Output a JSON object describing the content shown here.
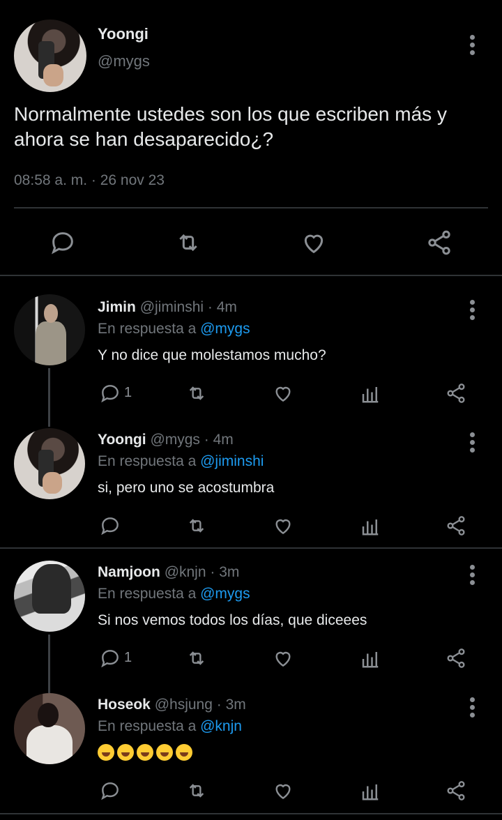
{
  "main_tweet": {
    "name": "Yoongi",
    "handle": "@mygs",
    "text": "Normalmente ustedes son los que escriben más y ahora se han desaparecido¿?",
    "meta": "08:58 a. m. · 26 nov 23"
  },
  "replies": [
    {
      "name": "Jimin",
      "handle": "@jiminshi",
      "time": "· 4m",
      "reply_prefix": "En respuesta a",
      "reply_to": "@mygs",
      "text": "Y no dice que molestamos mucho?",
      "reply_count": "1"
    },
    {
      "name": "Yoongi",
      "handle": "@mygs",
      "time": "· 4m",
      "reply_prefix": "En respuesta a",
      "reply_to": "@jiminshi",
      "text": "si, pero uno se acostumbra",
      "reply_count": ""
    },
    {
      "name": "Namjoon",
      "handle": "@knjn",
      "time": "· 3m",
      "reply_prefix": "En respuesta a",
      "reply_to": "@mygs",
      "text": "Si nos vemos todos los días, que diceees",
      "reply_count": "1"
    },
    {
      "name": "Hoseok",
      "handle": "@hsjung",
      "time": "· 3m",
      "reply_prefix": "En respuesta a",
      "reply_to": "@knjn",
      "text": "",
      "reply_count": "",
      "emojis": [
        "laughing-face",
        "laughing-face",
        "laughing-face",
        "laughing-face",
        "laughing-face"
      ]
    }
  ],
  "colors": {
    "background": "#000000",
    "link": "#1d9bf0",
    "muted": "#71767b",
    "divider": "#2f3336"
  }
}
